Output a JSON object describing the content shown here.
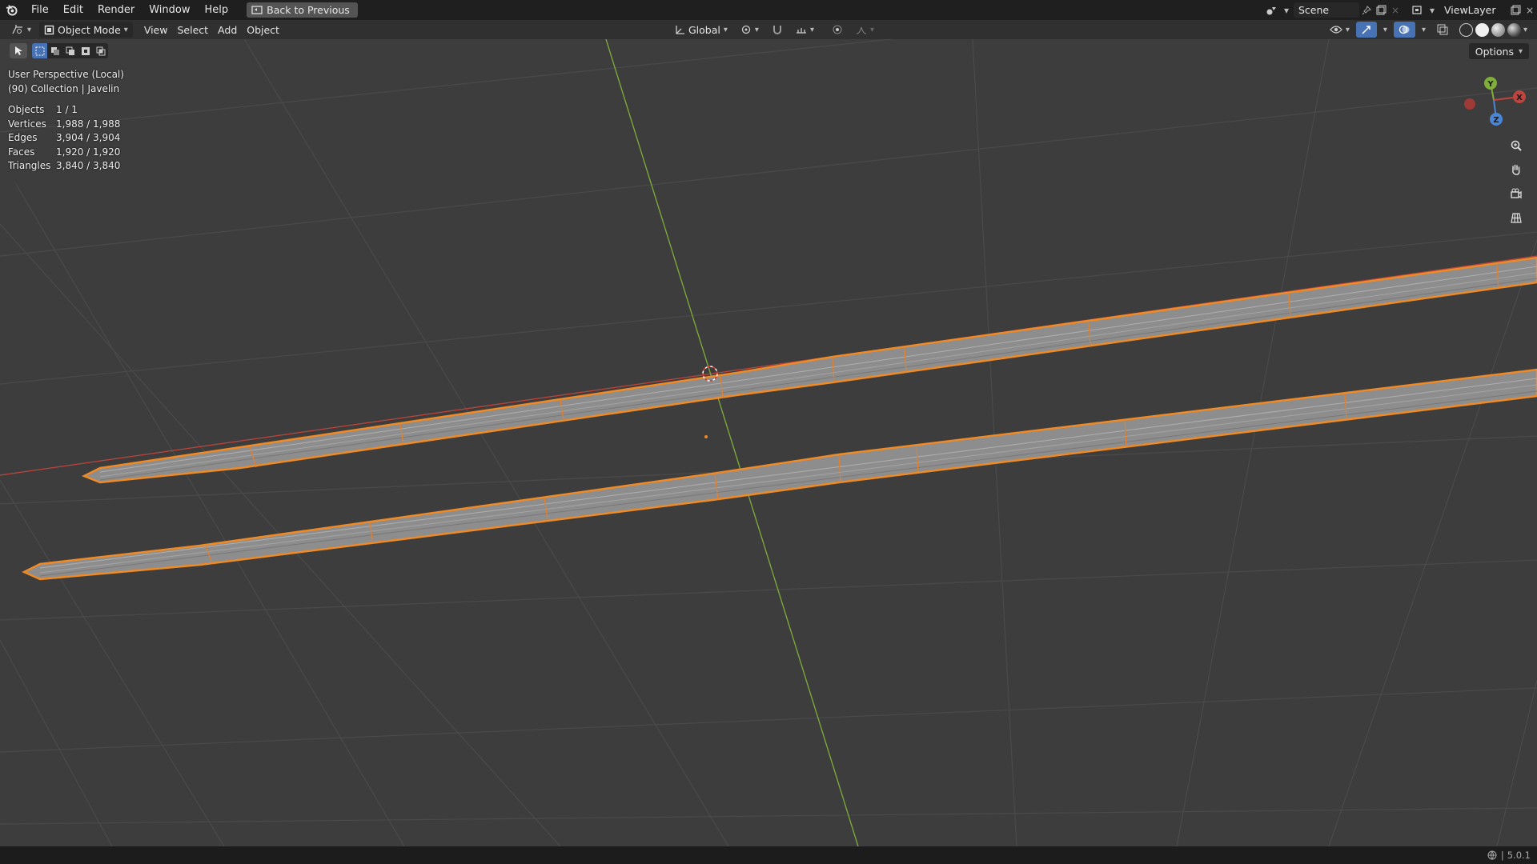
{
  "topbar": {
    "menus": [
      "File",
      "Edit",
      "Render",
      "Window",
      "Help"
    ],
    "back_button": "Back to Previous",
    "scene": "Scene",
    "view_layer": "ViewLayer"
  },
  "header": {
    "mode": "Object Mode",
    "menus": [
      "View",
      "Select",
      "Add",
      "Object"
    ],
    "transform_orientation": "Global",
    "options": "Options"
  },
  "viewport": {
    "perspective": "User Perspective (Local)",
    "collection": "(90) Collection | Javelin",
    "stats": [
      {
        "label": "Objects",
        "value": "1 / 1"
      },
      {
        "label": "Vertices",
        "value": "1,988 / 1,988"
      },
      {
        "label": "Edges",
        "value": "3,904 / 3,904"
      },
      {
        "label": "Faces",
        "value": "1,920 / 1,920"
      },
      {
        "label": "Triangles",
        "value": "3,840 / 3,840"
      }
    ]
  },
  "gizmo": {
    "y": "Y",
    "x": "X",
    "z": "Z"
  },
  "status": {
    "version": "5.0.1"
  },
  "colors": {
    "selection": "#f08a24",
    "axis_x": "#c0443e",
    "axis_y": "#7fae3a",
    "background": "#3d3d3d"
  }
}
